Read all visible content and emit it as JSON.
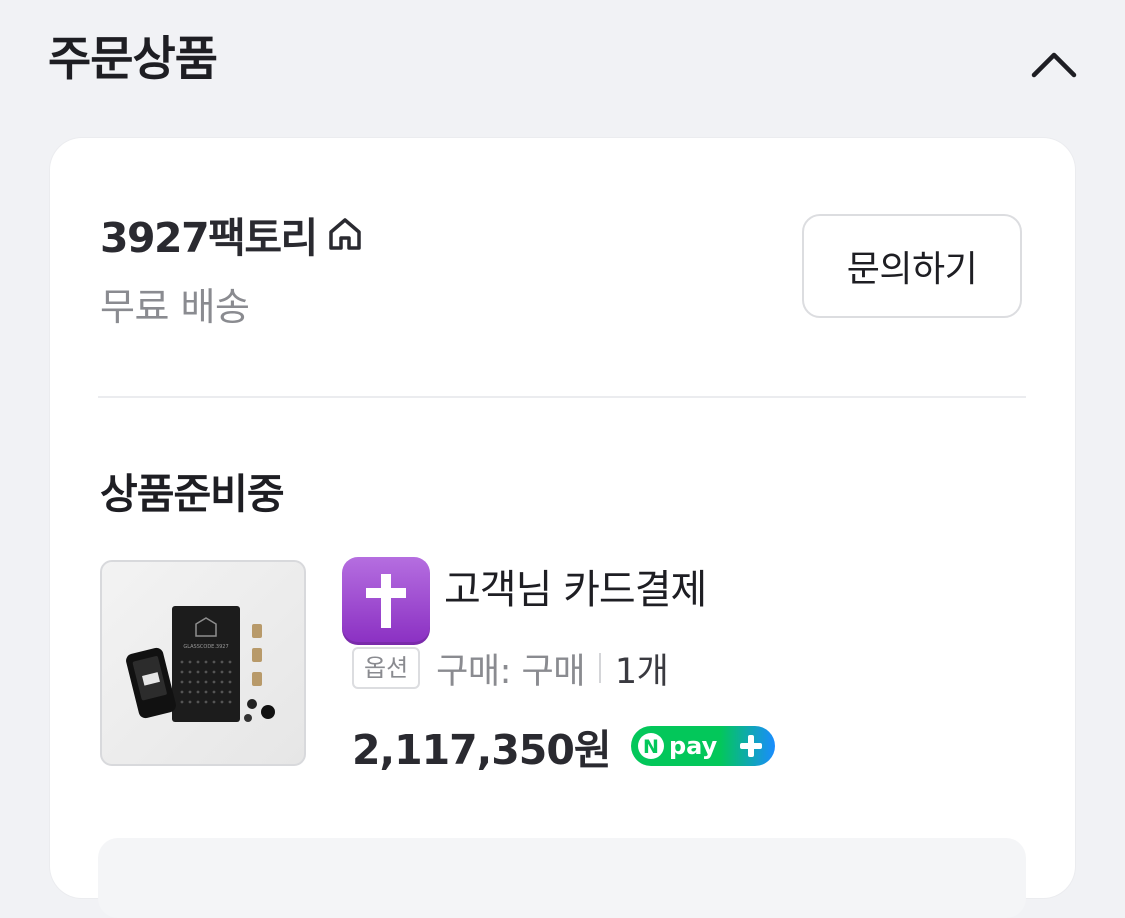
{
  "section": {
    "title": "주문상품",
    "collapse_icon": "chevron-up-icon"
  },
  "seller": {
    "name": "3927팩토리",
    "home_icon": "home-icon",
    "shipping": "무료 배송",
    "inquiry_label": "문의하기"
  },
  "order": {
    "status": "상품준비중",
    "items": [
      {
        "badge_icon": "latin-cross-emoji",
        "name": "고객님 카드결제",
        "option_tag": "옵션",
        "option_value": "구매: 구매",
        "quantity": "1개",
        "price": "2,117,350원",
        "pay_badge": "npay+",
        "thumbnail_text": "GLASSCODE.3927"
      }
    ]
  },
  "colors": {
    "background": "#f1f2f5",
    "card": "#ffffff",
    "npay_green": "#03c75a",
    "npay_blue": "#1a8cff",
    "badge_purple": "#9a3fd0"
  }
}
